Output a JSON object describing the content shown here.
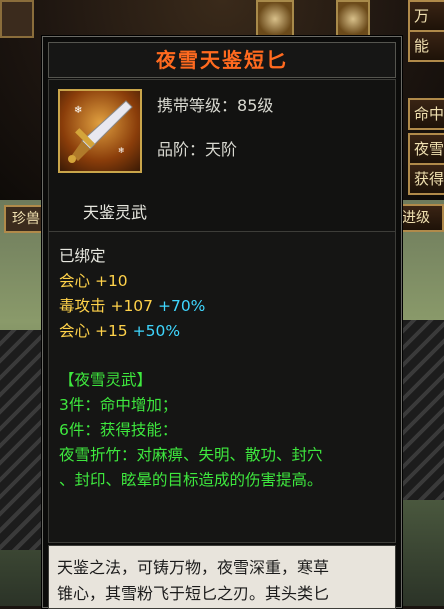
{
  "background": {
    "top_right_buttons": [
      "万",
      "能",
      "命中",
      "夜雪",
      "获得"
    ],
    "left_tab": "珍兽",
    "right_tab": "进级"
  },
  "tooltip": {
    "title": "夜雪天鉴短匕",
    "carry_level_label": "携带等级：",
    "carry_level_value": "85级",
    "grade_label": "品阶：",
    "grade_value": "天阶",
    "spirit_name": "天鉴灵武",
    "bound": "已绑定",
    "stats": [
      {
        "name": "会心",
        "base": "+10",
        "bonus": ""
      },
      {
        "name": "毒攻击",
        "base": "+107",
        "bonus": "+70%"
      },
      {
        "name": "会心",
        "base": "+15",
        "bonus": "+50%"
      }
    ],
    "set_name": "【夜雪灵武】",
    "set_effects": [
      "3件：命中增加；",
      "6件：获得技能：",
      "夜雪折竹：对麻痹、失明、散功、封穴",
      "、封印、眩晕的目标造成的伤害提高。"
    ],
    "description": [
      "天鉴之法，可铸万物，夜雪深重，寒草",
      "锥心，其雪粉飞于短匕之刃。其头类匕"
    ]
  },
  "colors": {
    "title": "#ff6a1f",
    "stat_yellow": "#ffd24a",
    "bonus_cyan": "#3fd7ff",
    "set_green": "#3ee83e"
  }
}
